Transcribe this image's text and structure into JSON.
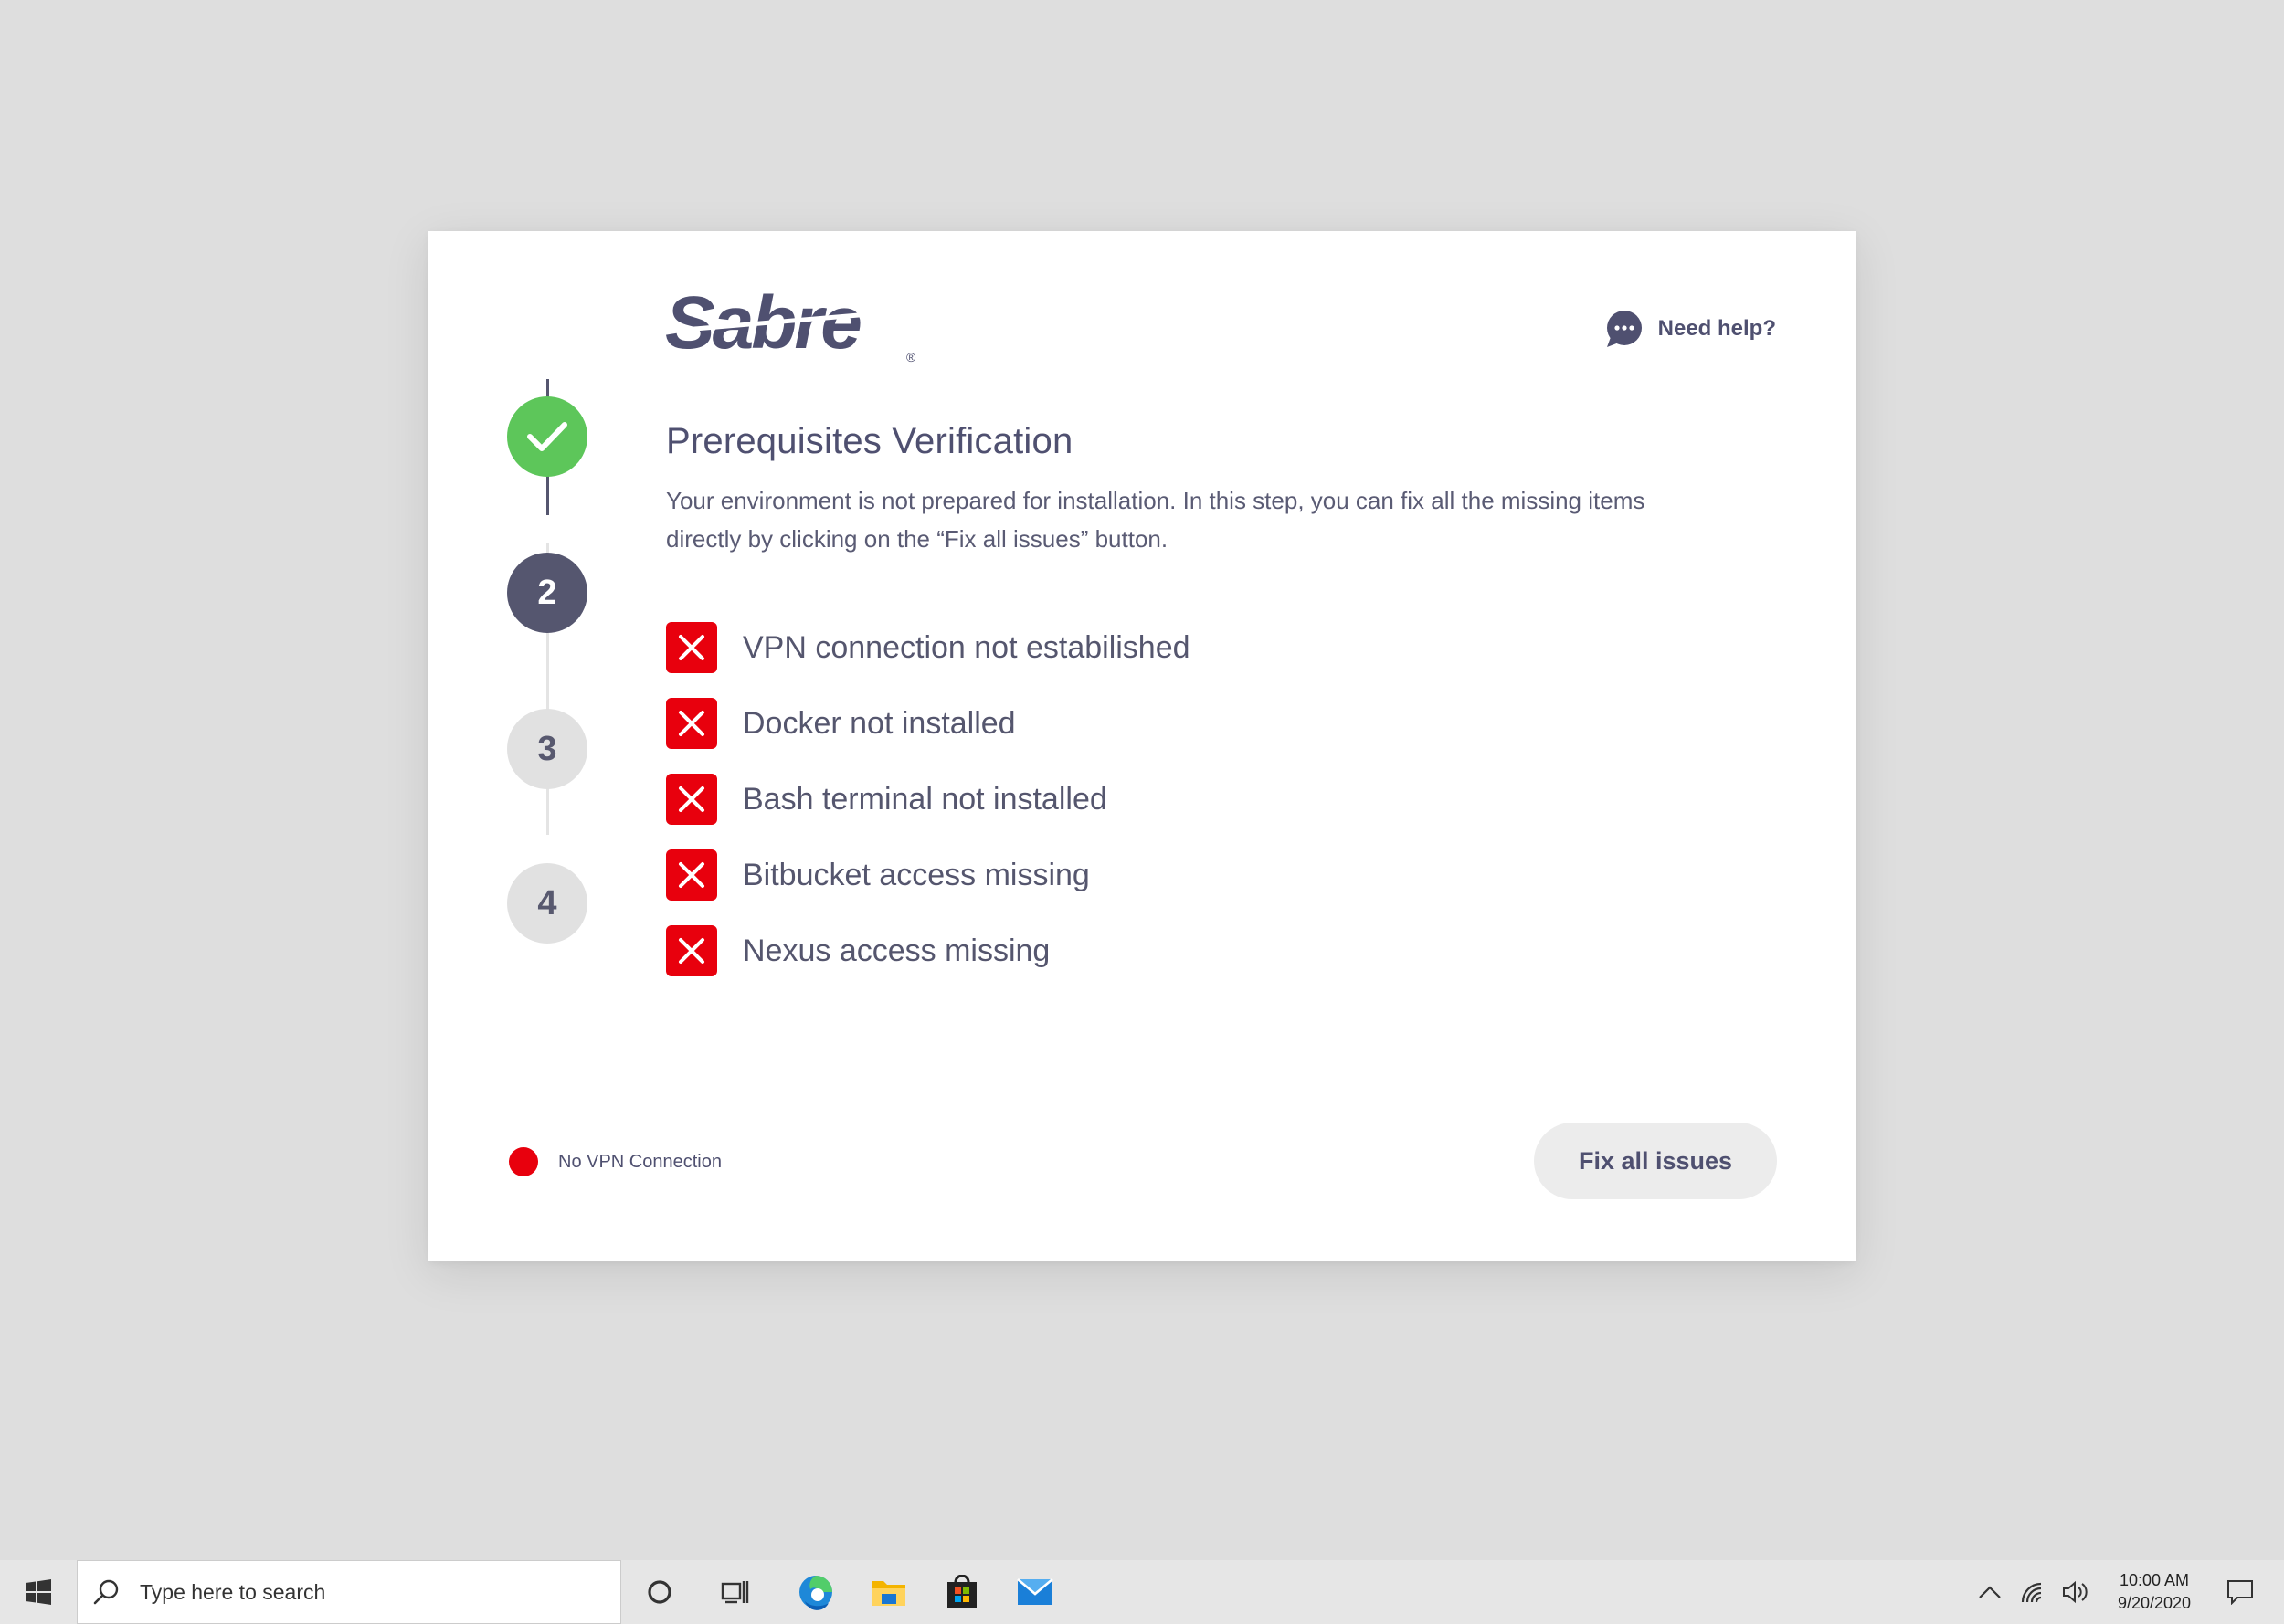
{
  "brand": {
    "logo_text": "Sabre",
    "logo_mark": "®"
  },
  "help": {
    "label": "Need help?",
    "icon": "chat-bubble-icon"
  },
  "stepper": {
    "steps": [
      {
        "label": "",
        "state": "completed",
        "icon": "checkmark-icon"
      },
      {
        "label": "2",
        "state": "active"
      },
      {
        "label": "3",
        "state": "pending"
      },
      {
        "label": "4",
        "state": "pending"
      }
    ]
  },
  "content": {
    "title": "Prerequisites Verification",
    "description": "Your environment is not prepared for installation. In this step, you can fix all the missing items directly by clicking on the “Fix all issues” button.",
    "issues": [
      {
        "label": "VPN connection not estabilished",
        "status": "error",
        "icon": "x-mark-icon"
      },
      {
        "label": "Docker not installed",
        "status": "error",
        "icon": "x-mark-icon"
      },
      {
        "label": "Bash terminal not installed",
        "status": "error",
        "icon": "x-mark-icon"
      },
      {
        "label": "Bitbucket access missing",
        "status": "error",
        "icon": "x-mark-icon"
      },
      {
        "label": "Nexus access missing",
        "status": "error",
        "icon": "x-mark-icon"
      }
    ]
  },
  "footer": {
    "status_label": "No VPN Connection",
    "fix_button_label": "Fix all issues"
  },
  "taskbar": {
    "search_placeholder": "Type here to search",
    "time": "10:00 AM",
    "date": "9/20/2020",
    "pinned_apps": [
      "cortana-icon",
      "task-view-icon",
      "edge-icon",
      "file-explorer-icon",
      "store-icon",
      "mail-icon"
    ],
    "tray_icons": [
      "chevron-up-icon",
      "network-icon",
      "volume-icon",
      "notification-icon"
    ]
  },
  "colors": {
    "background": "#dedede",
    "text_primary": "#4f5070",
    "step_completed": "#5dc65a",
    "step_active": "#55566f",
    "step_pending": "#e1e1e1",
    "error": "#e8000d",
    "button_bg": "#ececec"
  }
}
